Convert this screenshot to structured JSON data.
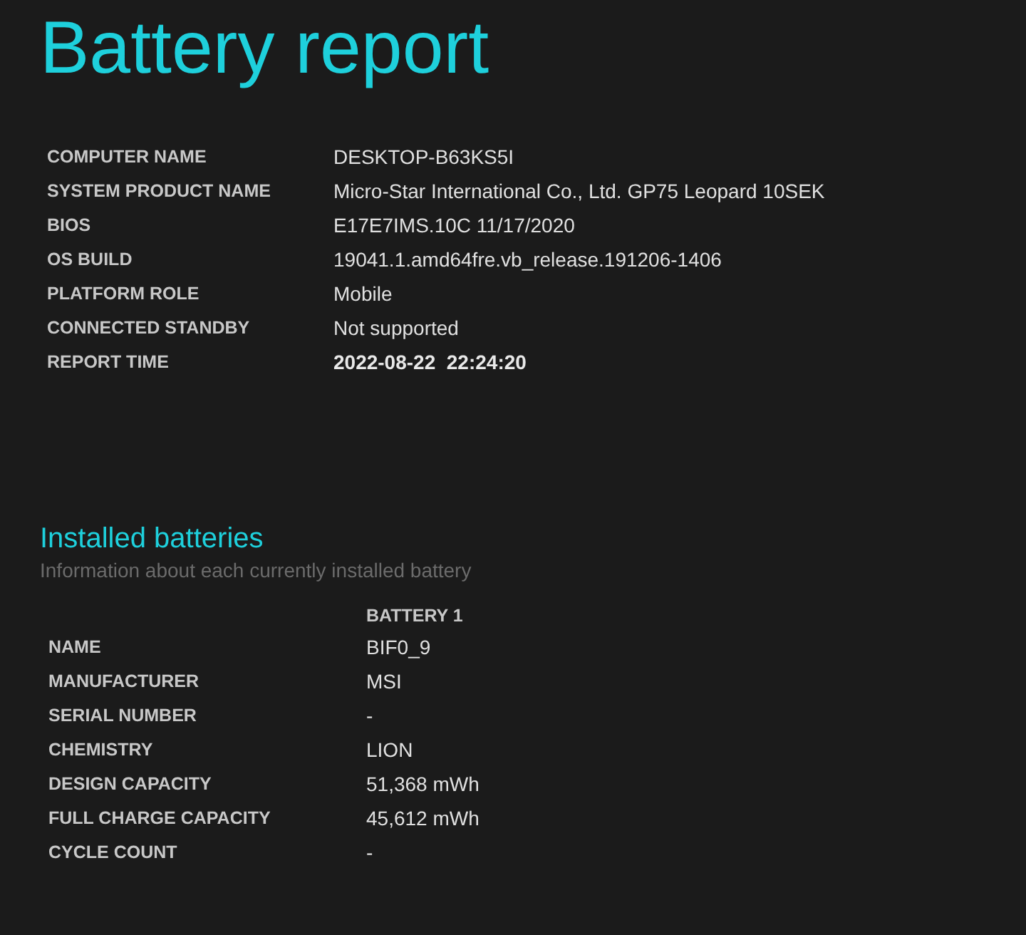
{
  "title": "Battery report",
  "system_info": [
    {
      "label": "COMPUTER NAME",
      "value": "DESKTOP-B63KS5I",
      "kind": "plain"
    },
    {
      "label": "SYSTEM PRODUCT NAME",
      "value": "Micro-Star International Co., Ltd. GP75 Leopard 10SEK",
      "kind": "plain"
    },
    {
      "label": "BIOS",
      "value": "E17E7IMS.10C 11/17/2020",
      "kind": "plain"
    },
    {
      "label": "OS BUILD",
      "value": "19041.1.amd64fre.vb_release.191206-1406",
      "kind": "plain"
    },
    {
      "label": "PLATFORM ROLE",
      "value": "Mobile",
      "kind": "plain"
    },
    {
      "label": "CONNECTED STANDBY",
      "value": "Not supported",
      "kind": "plain"
    },
    {
      "label": "REPORT TIME",
      "value": "2022-08-22  22:24:20",
      "kind": "emphasis"
    }
  ],
  "installed_batteries": {
    "heading": "Installed batteries",
    "subtitle": "Information about each currently installed battery",
    "columns": [
      "BATTERY 1"
    ],
    "rows": [
      {
        "label": "NAME",
        "value": "BIF0_9"
      },
      {
        "label": "MANUFACTURER",
        "value": "MSI"
      },
      {
        "label": "SERIAL NUMBER",
        "value": "-"
      },
      {
        "label": "CHEMISTRY",
        "value": "LION"
      },
      {
        "label": "DESIGN CAPACITY",
        "value": "51,368 mWh"
      },
      {
        "label": "FULL CHARGE CAPACITY",
        "value": "45,612 mWh"
      },
      {
        "label": "CYCLE COUNT",
        "value": "-"
      }
    ]
  }
}
